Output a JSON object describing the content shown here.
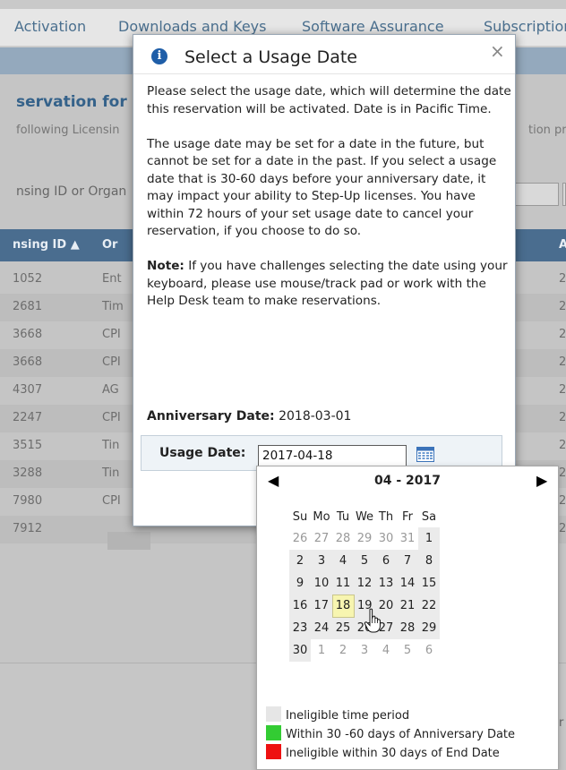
{
  "topnav": {
    "items": [
      "Activation",
      "Downloads and Keys",
      "Software Assurance",
      "Subscription"
    ]
  },
  "background": {
    "heading": "servation for",
    "subtitle_left": "following Licensin",
    "subtitle_right": "tion pr",
    "filter_label": "nsing ID or Organ",
    "table_headers": [
      "nsing ID ▲",
      "Or",
      "A"
    ],
    "rows": [
      {
        "id": "1052",
        "org": "Ent",
        "z": "2"
      },
      {
        "id": "2681",
        "org": "Tim",
        "z": "2"
      },
      {
        "id": "3668",
        "org": "CPI",
        "z": "2"
      },
      {
        "id": "3668",
        "org": "CPI",
        "z": "2"
      },
      {
        "id": "4307",
        "org": "AG",
        "z": "2"
      },
      {
        "id": "2247",
        "org": "CPI",
        "z": "2"
      },
      {
        "id": "3515",
        "org": "Tin",
        "z": "2"
      },
      {
        "id": "3288",
        "org": "Tin",
        "z": "2"
      },
      {
        "id": "7980",
        "org": "CPI",
        "z": "2"
      },
      {
        "id": "7912",
        "org": "",
        "z": "2"
      }
    ],
    "right_fragment": "r"
  },
  "modal": {
    "title": "Select a Usage Date",
    "close": "×",
    "para1": "Please select the usage date, which will determine the date this reservation will be activated. Date is in Pacific Time.",
    "para2": "The usage date may be set for a date in the future, but cannot be set for a date in the past. If you select a usage date that is 30-60 days before your anniversary date, it may impact your ability to Step-Up licenses. You have within 72 hours of your set usage date to cancel your reservation, if you choose to do so.",
    "note_label": "Note:",
    "note_text": " If you have challenges selecting the date using your keyboard, please use mouse/track pad or work with the Help Desk team to make reservations.",
    "anniversary_label": "Anniversary Date:",
    "anniversary_value": " 2018-03-01",
    "usage_label": "Usage Date:",
    "usage_value": "2017-04-18"
  },
  "calendar": {
    "month_label": "04 - 2017",
    "prev": "◀",
    "next": "▶",
    "weekdays": [
      "Su",
      "Mo",
      "Tu",
      "We",
      "Th",
      "Fr",
      "Sa"
    ],
    "weeks": [
      [
        "26",
        "27",
        "28",
        "29",
        "30",
        "31",
        "1"
      ],
      [
        "2",
        "3",
        "4",
        "5",
        "6",
        "7",
        "8"
      ],
      [
        "9",
        "10",
        "11",
        "12",
        "13",
        "14",
        "15"
      ],
      [
        "16",
        "17",
        "18",
        "19",
        "20",
        "21",
        "22"
      ],
      [
        "23",
        "24",
        "25",
        "26",
        "27",
        "28",
        "29"
      ],
      [
        "30",
        "1",
        "2",
        "3",
        "4",
        "5",
        "6"
      ]
    ],
    "selected_day": "18",
    "legend": [
      {
        "label": "Ineligible time period",
        "color": "#e6e6e6"
      },
      {
        "label": "Within 30 -60 days of Anniversary Date",
        "color": "#33cc33"
      },
      {
        "label": "Ineligible within 30 days of End Date",
        "color": "#ee1111"
      }
    ]
  },
  "colors": {
    "nav_text": "#4a6f8e",
    "table_header": "#4a6d8f",
    "info_icon": "#1f5ea8",
    "selected_day": "#f7f5b0"
  }
}
